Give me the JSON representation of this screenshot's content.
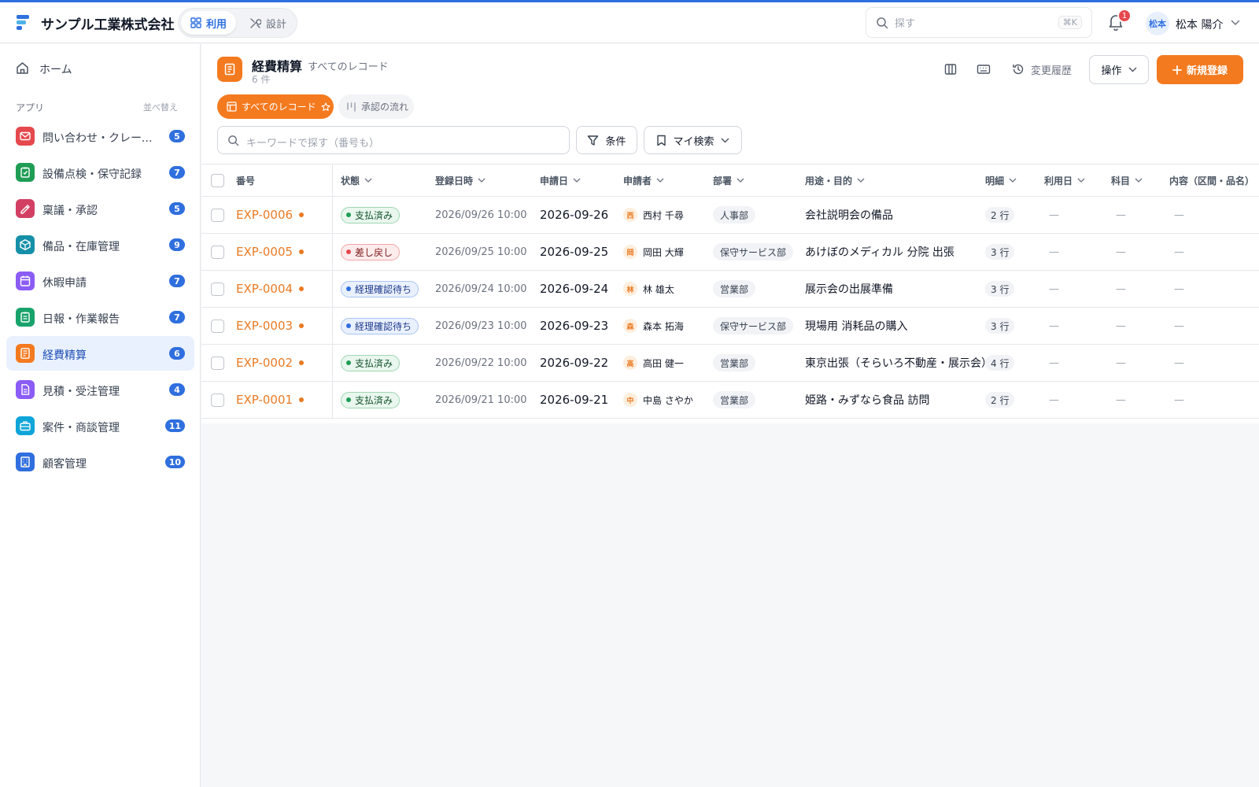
{
  "header": {
    "company": "サンプル工業株式会社",
    "mode_use": "利用",
    "mode_design": "設計",
    "search_placeholder": "探す",
    "search_shortcut": "⌘K",
    "notification_count": "1",
    "user_initials": "松本",
    "user_name": "松本 陽介"
  },
  "sidebar": {
    "home": "ホーム",
    "section_label": "アプリ",
    "sort_label": "並べ替え",
    "apps": [
      {
        "label": "問い合わせ・クレーム管理",
        "count": "5",
        "icon": "mail-icon",
        "color": "#e5484d"
      },
      {
        "label": "設備点検・保守記録",
        "count": "7",
        "icon": "clipboard-check-icon",
        "color": "#1f9d55"
      },
      {
        "label": "稟議・承認",
        "count": "5",
        "icon": "signature-icon",
        "color": "#d23f63"
      },
      {
        "label": "備品・在庫管理",
        "count": "9",
        "icon": "box-icon",
        "color": "#1690a8"
      },
      {
        "label": "休暇申請",
        "count": "7",
        "icon": "calendar-icon",
        "color": "#8b5cf6"
      },
      {
        "label": "日報・作業報告",
        "count": "7",
        "icon": "clipboard-icon",
        "color": "#17a36b"
      },
      {
        "label": "経費精算",
        "count": "6",
        "icon": "receipt-icon",
        "color": "#f47a1f",
        "active": true
      },
      {
        "label": "見積・受注管理",
        "count": "4",
        "icon": "document-icon",
        "color": "#8b5cf6"
      },
      {
        "label": "案件・商談管理",
        "count": "11",
        "icon": "briefcase-icon",
        "color": "#0ea5d9"
      },
      {
        "label": "顧客管理",
        "count": "10",
        "icon": "building-icon",
        "color": "#2f6fde"
      }
    ]
  },
  "page": {
    "title": "経費精算",
    "subtitle": "すべてのレコード",
    "count": "6 件",
    "history_label": "変更履歴",
    "ops_label": "操作",
    "new_label": "新規登録",
    "view_all": "すべてのレコード",
    "view_flow": "承認の流れ",
    "keyword_placeholder": "キーワードで探す（番号も）",
    "filter_label": "条件",
    "mysearch_label": "マイ検索"
  },
  "table": {
    "columns": [
      "番号",
      "状態",
      "登録日時",
      "申請日",
      "申請者",
      "部署",
      "用途・目的",
      "明細",
      "利用日",
      "科目",
      "内容（区間・品名）"
    ],
    "status_styles": {
      "支払済み": {
        "bg": "#e9f7ee",
        "border": "#9fd6b2",
        "dot": "#1f9d55",
        "text": "#14532d"
      },
      "差し戻し": {
        "bg": "#fdecec",
        "border": "#f3a5a5",
        "dot": "#e5484d",
        "text": "#7f1d1d"
      },
      "経理確認待ち": {
        "bg": "#eaf1fe",
        "border": "#a9c3f3",
        "dot": "#2f6fde",
        "text": "#1e3a8a"
      }
    },
    "rows": [
      {
        "id": "EXP-0006",
        "status": "支払済み",
        "registered": "2026/09/26 10:00",
        "date": "2026-09-26",
        "initial": "西",
        "applicant": "西村 千尋",
        "dept": "人事部",
        "purpose": "会社説明会の備品",
        "lines": "2 行",
        "use_date": "—",
        "subject": "—",
        "content": "—"
      },
      {
        "id": "EXP-0005",
        "status": "差し戻し",
        "registered": "2026/09/25 10:00",
        "date": "2026-09-25",
        "initial": "岡",
        "applicant": "岡田 大輝",
        "dept": "保守サービス部",
        "purpose": "あけぼのメディカル 分院 出張",
        "lines": "3 行",
        "use_date": "—",
        "subject": "—",
        "content": "—"
      },
      {
        "id": "EXP-0004",
        "status": "経理確認待ち",
        "registered": "2026/09/24 10:00",
        "date": "2026-09-24",
        "initial": "林",
        "applicant": "林 雄太",
        "dept": "営業部",
        "purpose": "展示会の出展準備",
        "lines": "3 行",
        "use_date": "—",
        "subject": "—",
        "content": "—"
      },
      {
        "id": "EXP-0003",
        "status": "経理確認待ち",
        "registered": "2026/09/23 10:00",
        "date": "2026-09-23",
        "initial": "森",
        "applicant": "森本 拓海",
        "dept": "保守サービス部",
        "purpose": "現場用 消耗品の購入",
        "lines": "3 行",
        "use_date": "—",
        "subject": "—",
        "content": "—"
      },
      {
        "id": "EXP-0002",
        "status": "支払済み",
        "registered": "2026/09/22 10:00",
        "date": "2026-09-22",
        "initial": "高",
        "applicant": "高田 健一",
        "dept": "営業部",
        "purpose": "東京出張（そらいろ不動産・展示会）",
        "lines": "4 行",
        "use_date": "—",
        "subject": "—",
        "content": "—"
      },
      {
        "id": "EXP-0001",
        "status": "支払済み",
        "registered": "2026/09/21 10:00",
        "date": "2026-09-21",
        "initial": "中",
        "applicant": "中島 さやか",
        "dept": "営業部",
        "purpose": "姫路・みずなら食品 訪問",
        "lines": "2 行",
        "use_date": "—",
        "subject": "—",
        "content": "—"
      }
    ]
  },
  "colors": {
    "accent": "#2f6fde",
    "brand_orange": "#f47a1f"
  }
}
